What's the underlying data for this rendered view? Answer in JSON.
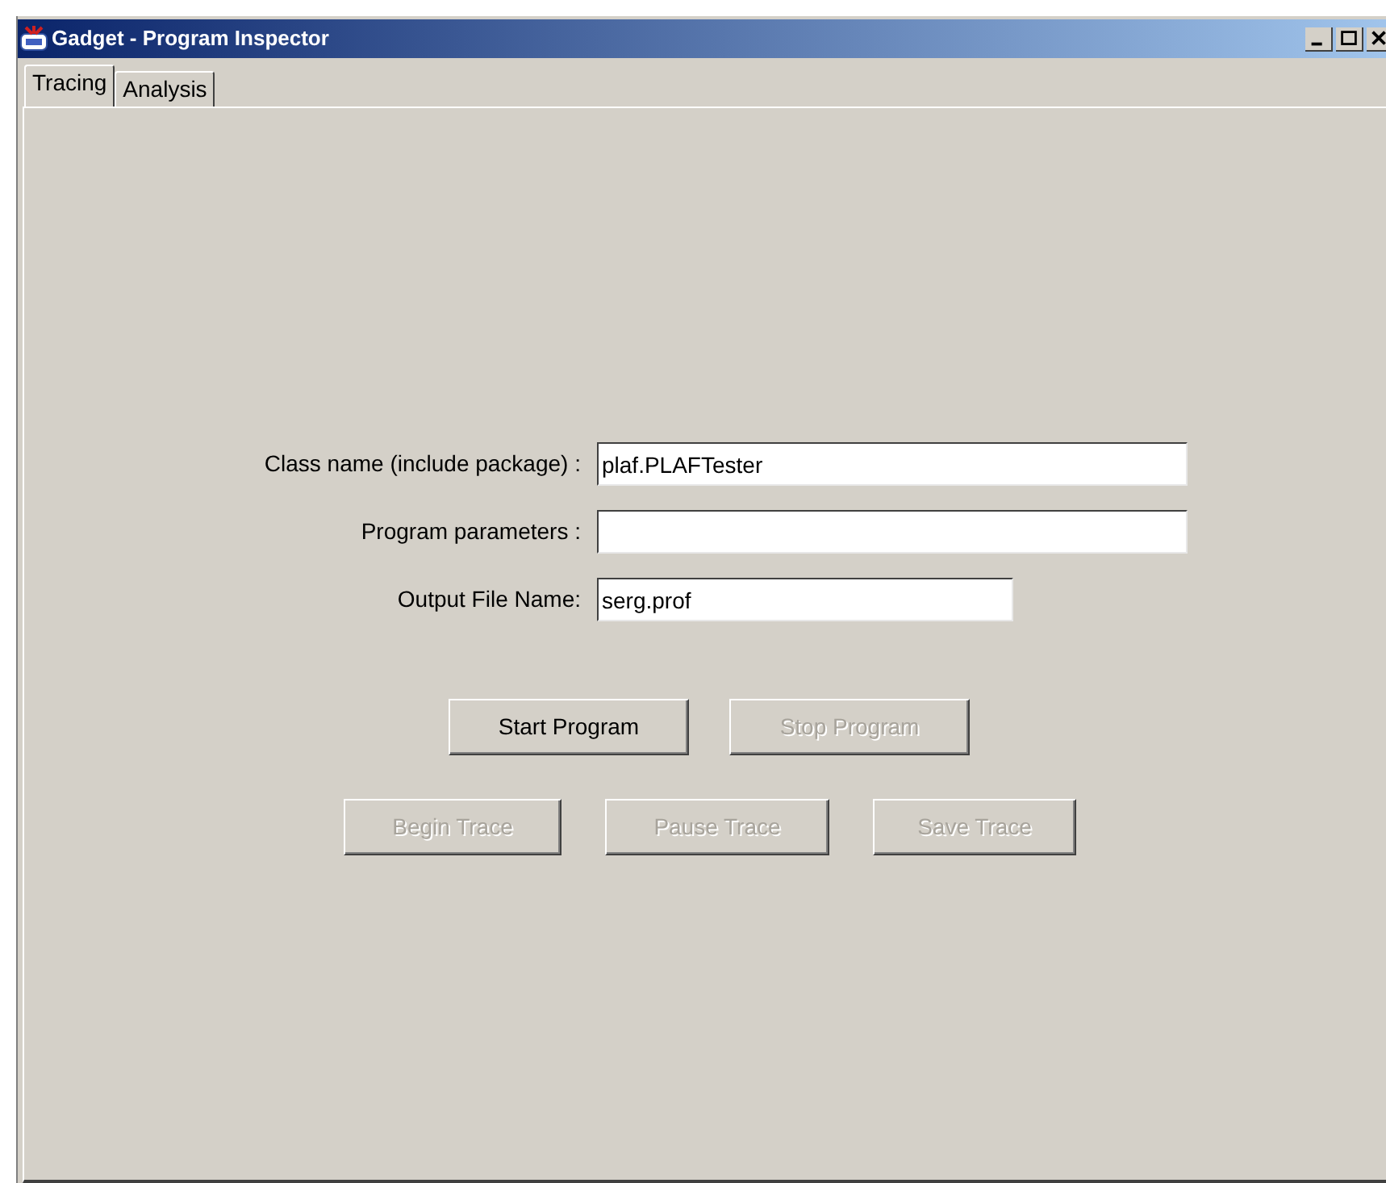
{
  "window": {
    "title": "Gadget - Program Inspector"
  },
  "tabs": [
    {
      "label": "Tracing",
      "selected": true
    },
    {
      "label": "Analysis",
      "selected": false
    }
  ],
  "fields": [
    {
      "label": "Class name (include package) :",
      "value": "plaf.PLAFTester",
      "kind": "wide"
    },
    {
      "label": "Program parameters :",
      "kind": "wide"
    },
    {
      "label": "Output File Name:",
      "value": "serg.prof",
      "kind": "narrow"
    }
  ],
  "program_buttons": [
    {
      "label": "Start Program",
      "disabled": false
    },
    {
      "label": "Stop Program",
      "disabled": true
    }
  ],
  "trace_buttons": [
    {
      "label": "Begin Trace",
      "disabled": true
    },
    {
      "label": "Pause Trace",
      "disabled": true
    },
    {
      "label": "Save Trace",
      "disabled": true
    }
  ]
}
